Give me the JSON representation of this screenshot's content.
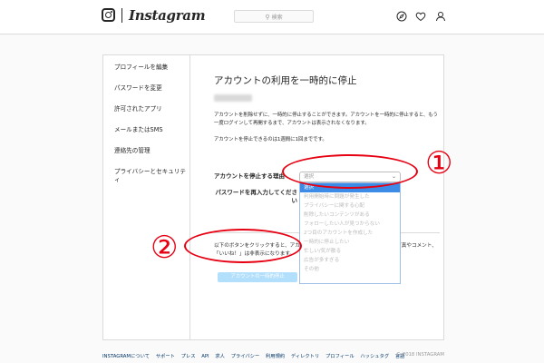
{
  "header": {
    "wordmark": "Instagram",
    "search_placeholder": "検索",
    "search_icon": "magnifier-icon",
    "nav_icons": [
      "compass-icon",
      "heart-icon",
      "person-icon"
    ]
  },
  "sidebar": {
    "items": [
      {
        "label": "プロフィールを編集"
      },
      {
        "label": "パスワードを変更"
      },
      {
        "label": "許可されたアプリ"
      },
      {
        "label": "メールまたはSMS"
      },
      {
        "label": "連絡先の管理"
      },
      {
        "label": "プライバシーとセキュリティ"
      }
    ]
  },
  "main": {
    "title": "アカウントの利用を一時的に停止",
    "description": "アカウントを削除せずに、一時的に停止することができます。アカウントを一時的に停止すると、もう一度ログインして再開するまで、アカウントは表示されなくなります。",
    "note": "アカウントを停止できるのは1週間に1回までです。",
    "reason_label": "アカウントを停止する理由",
    "password_label": "パスワードを再入力してください",
    "select_value": "選択",
    "dropdown_options": [
      "選択",
      "利用開始時に問題が発生した",
      "プライバシーに関する心配",
      "削除したいコンテンツがある",
      "フォローしたい人が見つからない",
      "2つ目のアカウントを作成した",
      "一時的に停止したい",
      "忙しい/気が散る",
      "広告が多すぎる",
      "その他"
    ],
    "bottom_text": "以下のボタンをクリックすると、アカウントは一時的に停止され、アカウントの写真やコメント、「いいね！」は非表示になります。",
    "disable_button": "アカウントの一時的停止"
  },
  "annotations": {
    "marker_1": "①",
    "marker_2": "②",
    "color": "#e60012"
  },
  "footer": {
    "links": [
      "INSTAGRAMについて",
      "サポート",
      "プレス",
      "API",
      "求人",
      "プライバシー",
      "利用規約",
      "ディレクトリ",
      "プロフィール",
      "ハッシュタグ",
      "言語"
    ],
    "copyright": "© 2018 INSTAGRAM"
  },
  "colors": {
    "accent_blue": "#3c8be6",
    "button_disabled": "#b2dffc",
    "link": "#003569"
  }
}
